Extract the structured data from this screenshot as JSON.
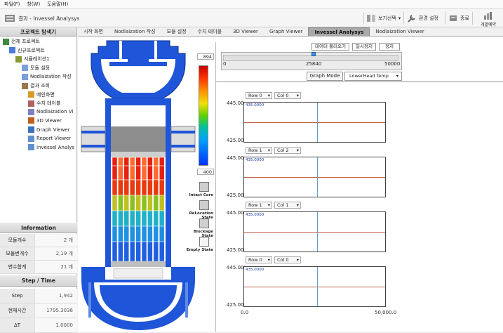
{
  "menu": [
    "파일(F)",
    "창(W)",
    "도움말(H)"
  ],
  "app_title": "결과 - Invessel Analysys",
  "toolbar": [
    {
      "label": "보기선택",
      "icon": "view-icon"
    },
    {
      "label": "환경 설정",
      "icon": "wrench-icon"
    },
    {
      "label": "종료",
      "icon": "exit-icon"
    },
    {
      "label": "개발예약",
      "icon": "chart-icon"
    }
  ],
  "explorer": {
    "title": "프로젝트 탐색기",
    "items": [
      {
        "label": "전체 프로젝트",
        "level": 0
      },
      {
        "label": "신규프로젝트",
        "level": 1
      },
      {
        "label": "시뮬레이션1",
        "level": 2
      },
      {
        "label": "모듈 설정",
        "level": 3
      },
      {
        "label": "Nodlaization 작성",
        "level": 3
      },
      {
        "label": "결과 조회",
        "level": 3
      },
      {
        "label": "메인화면",
        "level": 4
      },
      {
        "label": "수치 테이블",
        "level": 4
      },
      {
        "label": "Nodlaization Vi",
        "level": 4
      },
      {
        "label": "3D Viewer",
        "level": 4
      },
      {
        "label": "Graph Viewer",
        "level": 4
      },
      {
        "label": "Report Viewer",
        "level": 4
      },
      {
        "label": "Invessel Analys",
        "level": 4
      }
    ]
  },
  "information": {
    "title": "Information",
    "rows": [
      {
        "label": "모듈개수",
        "value": "2 개"
      },
      {
        "label": "모듈변개수",
        "value": "2,19 개"
      },
      {
        "label": "변수합계",
        "value": "21 개"
      }
    ]
  },
  "step_time": {
    "title": "Step / Time",
    "rows": [
      {
        "label": "Step",
        "value": "1,942"
      },
      {
        "label": "현재시간",
        "value": "1795.3036"
      },
      {
        "label": "ΔT",
        "value": "1.0000"
      }
    ]
  },
  "tabs": [
    "시작 화면",
    "Nodlaization 작성",
    "모듈 설정",
    "수치 테이블",
    "3D Viewer",
    "Graph Viewer",
    "Invessel Analysys",
    "Nodlaization Viewer"
  ],
  "active_tab": 6,
  "colorbar": {
    "max": "894",
    "min": "400"
  },
  "states": [
    "Intact Core",
    "ReLocation State",
    "Blockage State",
    "Empty State"
  ],
  "controls": {
    "load_data": "데이터 불러오기",
    "pause": "일시정지",
    "stop": "정지",
    "slider_min": "0",
    "slider_value": "25840",
    "slider_max": "50000",
    "slider_fraction": 0.5168,
    "graph_mode_label": "Graph Mode",
    "graph_mode_value": "LowerHead Temp"
  },
  "plots": [
    {
      "row": "Row 0",
      "col": "Col 0",
      "ymax": "445.00",
      "ymin": "425.00",
      "value": "435.0000"
    },
    {
      "row": "Row 1",
      "col": "Col 2",
      "ymax": "445.00",
      "ymin": "425.00",
      "value": "435.0000"
    },
    {
      "row": "Row 1",
      "col": "Col 1",
      "ymax": "445.00",
      "ymin": "425.00",
      "value": "435.0000"
    },
    {
      "row": "Row 0",
      "col": "Col 0",
      "ymax": "445.00",
      "ymin": "425.00",
      "value": "435.0000"
    }
  ],
  "x_axis": {
    "min": "0.0",
    "max": "50,000.0"
  },
  "colors": {
    "accent": "#3b8de0",
    "vessel_blue": "#1f55d8",
    "active_tab": "#a9a9a9"
  }
}
